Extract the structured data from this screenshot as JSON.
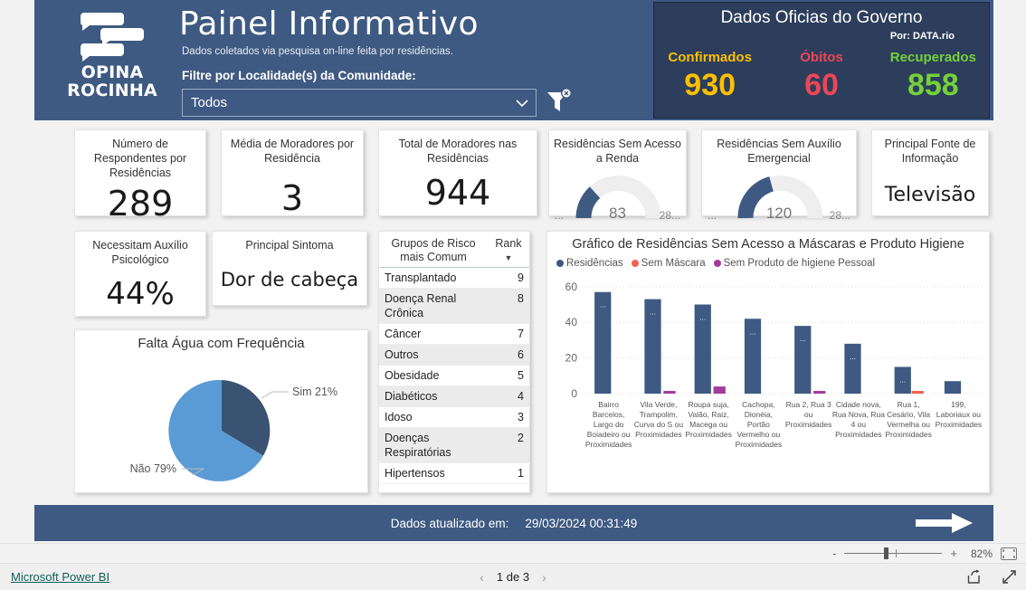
{
  "header": {
    "logo_line1": "OPINA",
    "logo_line2": "ROCINHA",
    "logo_icon": "speech-bubbles-icon",
    "title": "Painel Informativo",
    "subtitle": "Dados coletados via pesquisa on-line feita por residências.",
    "filter_label": "Filtre por Localidade(s) da Comunidade:",
    "slicer_value": "Todos",
    "slicer_placeholder": "Todos",
    "clear_filter_icon": "clear-filter-icon",
    "chevron_icon": "chevron-down-icon",
    "band_color": "#3e5a82"
  },
  "gov_panel": {
    "title": "Dados Oficias do Governo",
    "source": "Por: DATA.rio",
    "background": "#2c3e5c",
    "metrics": [
      {
        "label": "Confirmados",
        "value": "930",
        "color": "#ffc000"
      },
      {
        "label": "Óbitos",
        "value": "60",
        "color": "#ec4657"
      },
      {
        "label": "Recuperados",
        "value": "858",
        "color": "#76d13a"
      }
    ]
  },
  "cards": [
    {
      "title": "Número de Respondentes por Residências",
      "value": "289",
      "value_size": 38
    },
    {
      "title": "Média de Moradores por Residência",
      "value": "3",
      "value_size": 38
    },
    {
      "title": "Total de Moradores nas Residências",
      "value": "944",
      "value_size": 38
    },
    {
      "title": "Principal Fonte de Informação",
      "value": "Televisão",
      "value_size": 22
    },
    {
      "title": "Necessitam Auxílio Psicológico",
      "value": "44%",
      "value_size": 34
    },
    {
      "title": "Principal Sintoma",
      "value": "Dor de cabeça",
      "value_size": 21
    }
  ],
  "gauges": [
    {
      "title": "Residências Sem Acesso a Renda",
      "value": "83",
      "min_label": "...",
      "max_label": "28...",
      "fraction": 0.295,
      "color": "#3e5a82",
      "track": "#eeeeee"
    },
    {
      "title": "Residências Sem Auxílio Emergencial",
      "value": "120",
      "min_label": "...",
      "max_label": "28...",
      "fraction": 0.43,
      "color": "#3e5a82",
      "track": "#eeeeee"
    }
  ],
  "risk_table": {
    "columns": [
      "Grupos de Risco mais Comum",
      "Rank"
    ],
    "sort_indicator": "▼",
    "rows": [
      {
        "group": "Transplantado",
        "rank": "9"
      },
      {
        "group": "Doença Renal Crônica",
        "rank": "8"
      },
      {
        "group": "Câncer",
        "rank": "7"
      },
      {
        "group": "Outros",
        "rank": "6"
      },
      {
        "group": "Obesidade",
        "rank": "5"
      },
      {
        "group": "Diabéticos",
        "rank": "4"
      },
      {
        "group": "Idoso",
        "rank": "3"
      },
      {
        "group": "Doenças Respiratórias",
        "rank": "2"
      },
      {
        "group": "Hipertensos",
        "rank": "1"
      }
    ]
  },
  "footer": {
    "label": "Dados atualizado em:",
    "timestamp": "29/03/2024 00:31:49",
    "next_arrow_icon": "arrow-right-icon"
  },
  "zoombar": {
    "minus": "-",
    "plus": "+",
    "percent": "82%",
    "fit_icon": "fit-to-page-icon"
  },
  "statusbar": {
    "brand": "Microsoft Power BI",
    "prev_icon": "chevron-left-icon",
    "next_icon": "chevron-right-icon",
    "page_label": "1 de 3",
    "share_icon": "share-icon",
    "fullscreen_icon": "fullscreen-icon"
  },
  "chart_data": [
    {
      "type": "pie",
      "title": "Falta Água com Frequência",
      "labels": [
        "Não",
        "Sim"
      ],
      "values": [
        79,
        21
      ],
      "data_labels": [
        "Não 79%",
        "Sim 21%"
      ],
      "colors": [
        "#5b9bd5",
        "#3b5372"
      ],
      "legend": "none"
    },
    {
      "type": "bar",
      "title": "Gráfico de Residências Sem Acesso a Máscaras e Produto Higiene",
      "legend_position": "top",
      "ylabel": "",
      "xlabel": "",
      "ylim": [
        0,
        66
      ],
      "yticks": [
        0,
        20,
        40,
        60
      ],
      "grid": true,
      "categories": [
        "Bairro Barcelos, Largo do Boiadeiro ou Proximidades",
        "Vila Verde, Trampolim, Curva do S ou Proximidades",
        "Roupa suja, Valão, Raiz, Macega ou Proximidades",
        "Cachopa, Dionéia, Portão Vermelho ou Proximidades",
        "Rua 2, Rua 3 ou Proximidades",
        "Cidade nova, Rua Nova, Rua 4 ou Proximidades",
        "Rua 1, Cesário, Vila Vermelha ou Proximidades",
        "199, Laboriaux ou Proximidades"
      ],
      "series": [
        {
          "name": "Residências",
          "color": "#3e5a82",
          "values": [
            57,
            53,
            50,
            42,
            38,
            28,
            15,
            7
          ]
        },
        {
          "name": "Sem Máscara",
          "color": "#ee6352",
          "values": [
            0,
            0,
            0,
            0,
            0,
            0,
            1,
            0
          ]
        },
        {
          "name": "Sem Produto de higiene Pessoal",
          "color": "#a23b9c",
          "values": [
            0,
            1,
            4,
            0,
            1,
            0,
            0,
            0
          ]
        }
      ]
    }
  ]
}
